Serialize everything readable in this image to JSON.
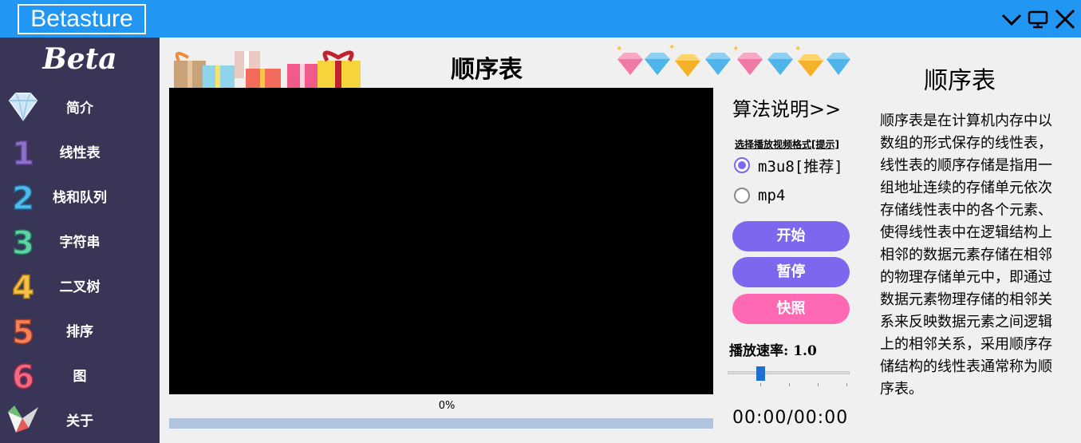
{
  "app": {
    "logo_text": "Betasture"
  },
  "window_controls": {
    "icons": [
      "chevron-down-icon",
      "monitor-icon",
      "close-icon"
    ]
  },
  "sidebar": {
    "brand": "Beta",
    "items": [
      {
        "label": "简介",
        "icon": "diamond-icon"
      },
      {
        "label": "线性表",
        "icon": "number-1-icon"
      },
      {
        "label": "栈和队列",
        "icon": "number-2-icon"
      },
      {
        "label": "字符串",
        "icon": "number-3-icon"
      },
      {
        "label": "二叉树",
        "icon": "number-4-icon"
      },
      {
        "label": "排序",
        "icon": "number-5-icon"
      },
      {
        "label": "图",
        "icon": "number-6-icon"
      },
      {
        "label": "关于",
        "icon": "paper-crane-icon"
      }
    ]
  },
  "main": {
    "title": "顺序表",
    "progress_text": "0%",
    "progress_value": 0
  },
  "controls": {
    "algo_link": "算法说明>>",
    "format_label": "选择播放视频格式[提示]",
    "formats": [
      {
        "label": "m3u8[推荐]",
        "selected": true
      },
      {
        "label": "mp4",
        "selected": false
      }
    ],
    "buttons": {
      "start": "开始",
      "pause": "暂停",
      "snapshot": "快照"
    },
    "speed_text": "播放速率: 1.0",
    "speed_value": 1.0,
    "speed_slider_fraction": 0.27,
    "timecode": "00:00/00:00"
  },
  "description": {
    "title": "顺序表",
    "body": "顺序表是在计算机内存中以数组的形式保存的线性表，线性表的顺序存储是指用一组地址连续的存储单元依次存储线性表中的各个元素、使得线性表中在逻辑结构上相邻的数据元素存储在相邻的物理存储单元中，即通过数据元素物理存储的相邻关系来反映数据元素之间逻辑上的相邻关系，采用顺序存储结构的线性表通常称为顺序表。"
  },
  "colors": {
    "titlebar": "#2196f3",
    "sidebar": "#393556",
    "button_purple": "#7b68ee",
    "button_pink": "#ff69b4",
    "progress_track": "#b0c4de"
  }
}
